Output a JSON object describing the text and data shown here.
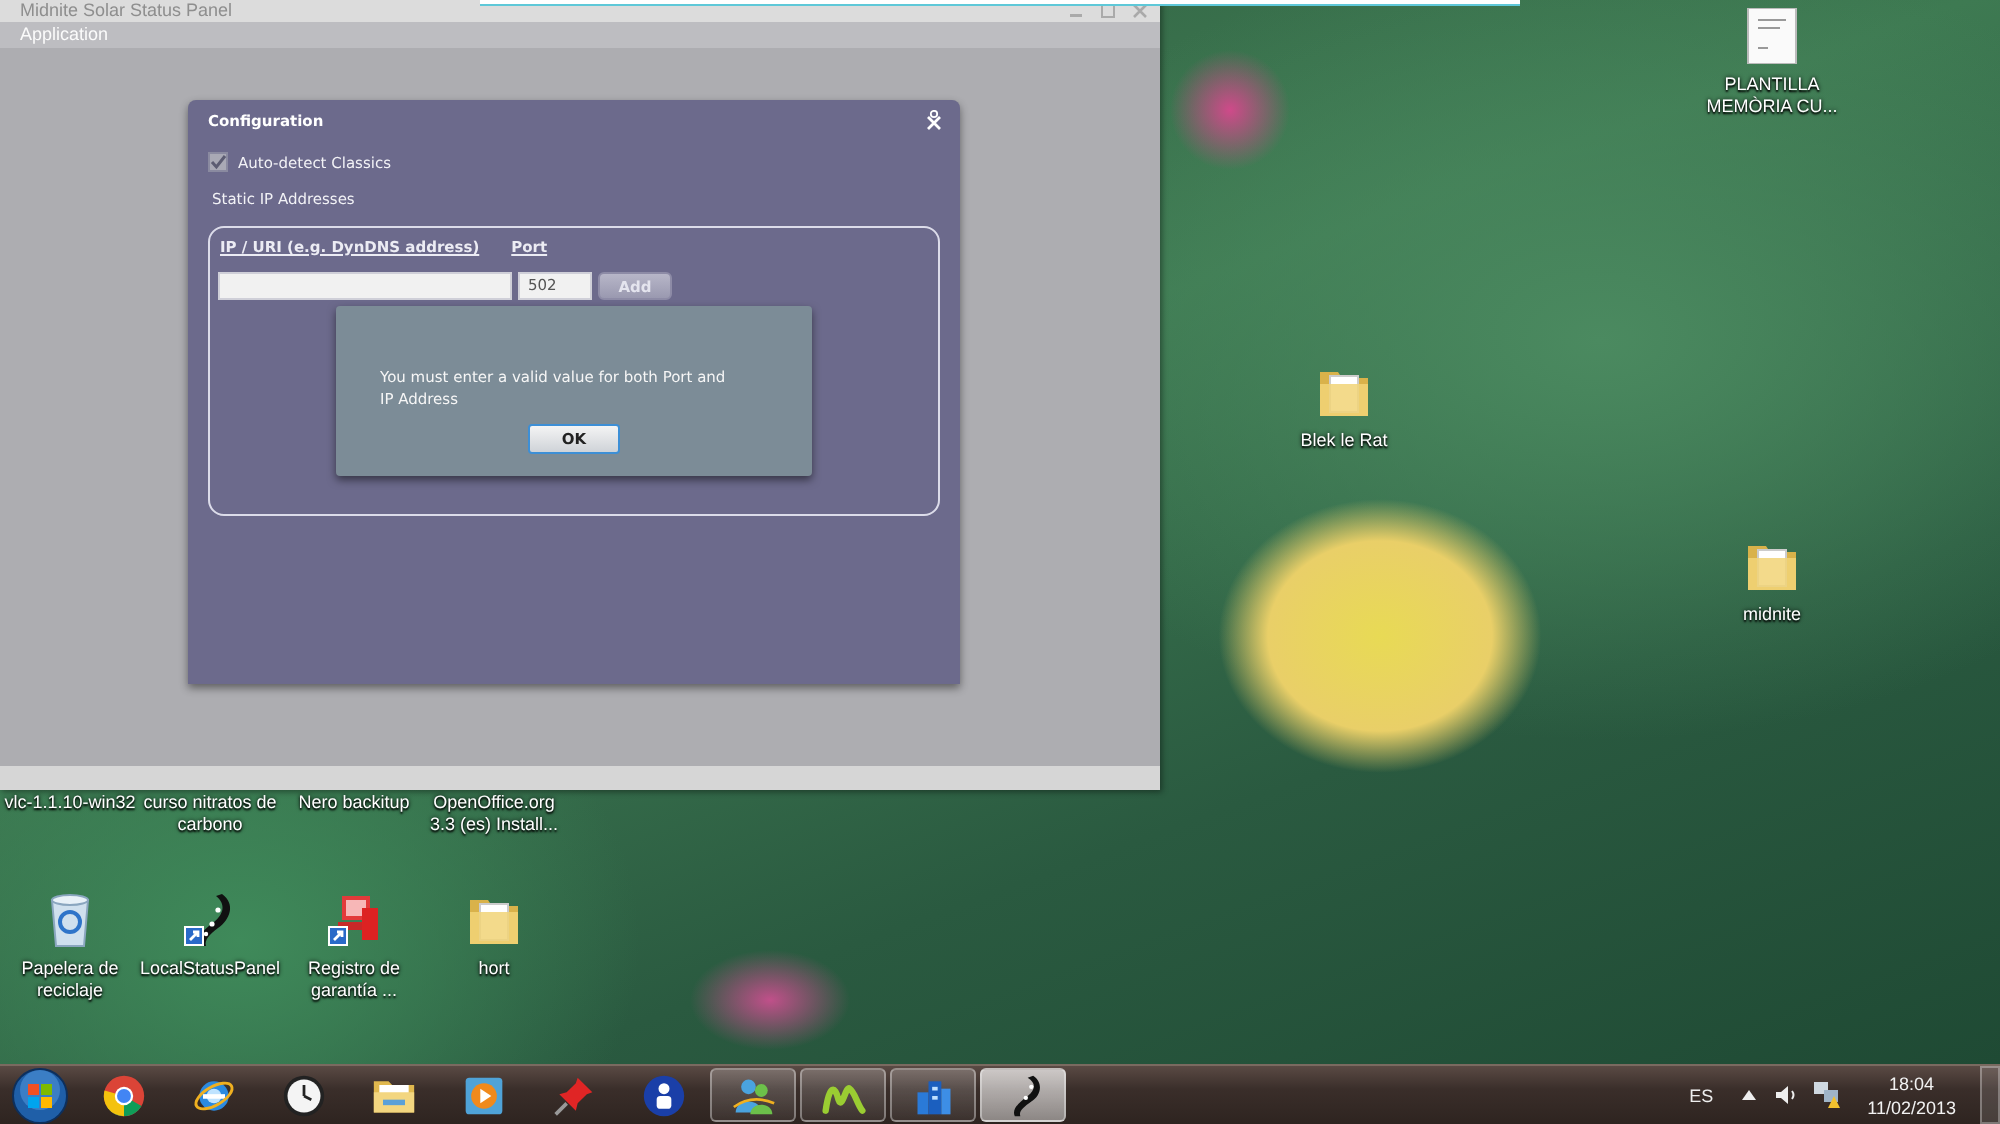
{
  "app_window": {
    "title": "Midnite Solar Status Panel",
    "menu": [
      "Application"
    ]
  },
  "configuration_dialog": {
    "title": "Configuration",
    "auto_detect": {
      "label": "Auto-detect Classics",
      "checked": true
    },
    "section_label": "Static IP Addresses",
    "columns": [
      "IP / URI (e.g. DynDNS address)",
      "Port"
    ],
    "port_field": {
      "value": "502"
    },
    "add_button": {
      "label": "Add",
      "disabled": true
    }
  },
  "message_box": {
    "text": "You must enter a valid value for both Port and IP Address",
    "buttons": [
      "OK"
    ]
  },
  "desktop_icons": [
    {
      "kind": "document",
      "lines": [
        "PLANTILLA",
        "MEMÒRIA CU..."
      ]
    },
    {
      "kind": "folder",
      "lines": [
        "Blek le Rat"
      ]
    },
    {
      "kind": "folder",
      "lines": [
        "midnite"
      ]
    },
    {
      "kind": "bin",
      "lines": [
        "Papelera de",
        "reciclaje"
      ]
    },
    {
      "kind": "creature",
      "lines": [
        "LocalStatusPanel"
      ]
    },
    {
      "kind": "register",
      "lines": [
        "Registro de",
        "garantía ..."
      ]
    },
    {
      "kind": "folder",
      "lines": [
        "hort"
      ]
    }
  ],
  "covered_icons": [
    {
      "lines": [
        "vlc-1.1.10-win32"
      ]
    },
    {
      "lines": [
        "curso nitratos de",
        "carbono"
      ]
    },
    {
      "lines": [
        "Nero backitup"
      ]
    },
    {
      "lines": [
        "OpenOffice.org",
        "3.3 (es) Install..."
      ]
    }
  ],
  "taskbar": {
    "buttons": [
      {
        "running": false,
        "selected": false
      },
      {
        "running": false,
        "selected": false
      },
      {
        "running": false,
        "selected": false
      },
      {
        "running": false,
        "selected": false
      },
      {
        "running": false,
        "selected": false
      },
      {
        "running": false,
        "selected": false
      },
      {
        "running": false,
        "selected": false
      },
      {
        "running": true,
        "selected": false
      },
      {
        "running": true,
        "selected": false
      },
      {
        "running": true,
        "selected": false
      },
      {
        "running": true,
        "selected": true
      }
    ]
  },
  "tray": {
    "language": "ES",
    "time": "18:04",
    "date": "11/02/2013"
  }
}
